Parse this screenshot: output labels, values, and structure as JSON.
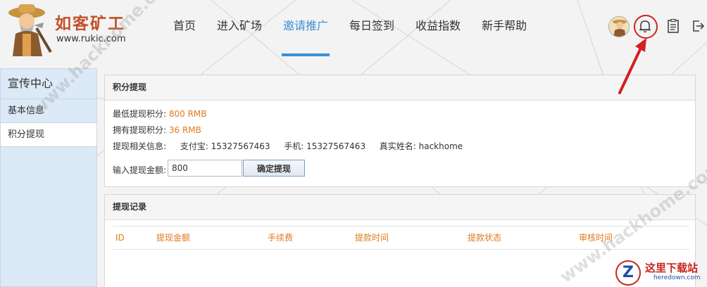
{
  "header": {
    "logo_title": "如客矿工",
    "logo_url": "www.rukic.com",
    "nav": [
      {
        "label": "首页",
        "active": false
      },
      {
        "label": "进入矿场",
        "active": false
      },
      {
        "label": "邀请推广",
        "active": true
      },
      {
        "label": "每日签到",
        "active": false
      },
      {
        "label": "收益指数",
        "active": false
      },
      {
        "label": "新手帮助",
        "active": false
      }
    ],
    "icons": [
      "avatar",
      "bell-icon",
      "clipboard-icon",
      "logout-icon"
    ]
  },
  "sidebar": {
    "title": "宣传中心",
    "items": [
      {
        "label": "基本信息",
        "active": false
      },
      {
        "label": "积分提现",
        "active": true
      }
    ]
  },
  "withdraw": {
    "title": "积分提现",
    "min_label": "最低提现积分:",
    "min_value": "800 RMB",
    "own_label": "拥有提现积分:",
    "own_value": "36 RMB",
    "info_label": "提现相关信息:",
    "alipay_label": "支付宝:",
    "alipay_value": "15327567463",
    "phone_label": "手机:",
    "phone_value": "15327567463",
    "name_label": "真实姓名:",
    "name_value": "hackhome",
    "input_label": "输入提现金额:",
    "input_value": "800",
    "submit_label": "确定提现"
  },
  "records": {
    "title": "提现记录",
    "columns": [
      "ID",
      "提现金额",
      "手续费",
      "提款时间",
      "提款状态",
      "审核时间"
    ]
  },
  "watermark": {
    "text": "www.hackhome.com",
    "badge_letter": "Z",
    "badge_name": "这里下载站",
    "badge_url": "heredown.com"
  },
  "colors": {
    "accent": "#3a8fd8",
    "highlight": "#e07a1c",
    "annotation": "#d32020"
  }
}
